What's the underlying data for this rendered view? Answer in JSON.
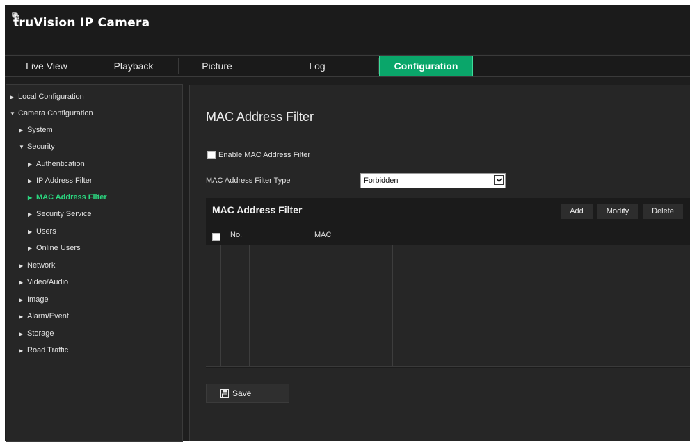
{
  "app": {
    "title": "truVision IP Camera"
  },
  "nav": {
    "tabs": [
      {
        "label": "Live View"
      },
      {
        "label": "Playback"
      },
      {
        "label": "Picture"
      },
      {
        "label": "Log"
      },
      {
        "label": "Configuration",
        "active": true
      }
    ]
  },
  "sidebar": {
    "items": [
      {
        "label": "Local Configuration",
        "expanded": false
      },
      {
        "label": "Camera Configuration",
        "expanded": true
      },
      {
        "label": "System",
        "expanded": false
      },
      {
        "label": "Security",
        "expanded": true
      },
      {
        "label": "Authentication",
        "expanded": false
      },
      {
        "label": "IP Address Filter",
        "expanded": false
      },
      {
        "label": "MAC Address Filter",
        "expanded": false,
        "active": true
      },
      {
        "label": "Security Service",
        "expanded": false
      },
      {
        "label": "Users",
        "expanded": false
      },
      {
        "label": "Online Users",
        "expanded": false
      },
      {
        "label": "Network",
        "expanded": false
      },
      {
        "label": "Video/Audio",
        "expanded": false
      },
      {
        "label": "Image",
        "expanded": false
      },
      {
        "label": "Alarm/Event",
        "expanded": false
      },
      {
        "label": "Storage",
        "expanded": false
      },
      {
        "label": "Road Traffic",
        "expanded": false
      }
    ]
  },
  "main": {
    "title": "MAC Address Filter",
    "enable_label": "Enable MAC Address Filter",
    "enable_checked": false,
    "filter_type_label": "MAC Address Filter Type",
    "filter_type_value": "Forbidden",
    "table": {
      "title": "MAC Address Filter",
      "buttons": {
        "add": "Add",
        "modify": "Modify",
        "delete": "Delete"
      },
      "columns": {
        "no": "No.",
        "mac": "MAC"
      },
      "rows": []
    },
    "save_label": "Save"
  },
  "colors": {
    "accent": "#0aa66a",
    "active_text": "#2bd57f",
    "background": "#262626"
  }
}
